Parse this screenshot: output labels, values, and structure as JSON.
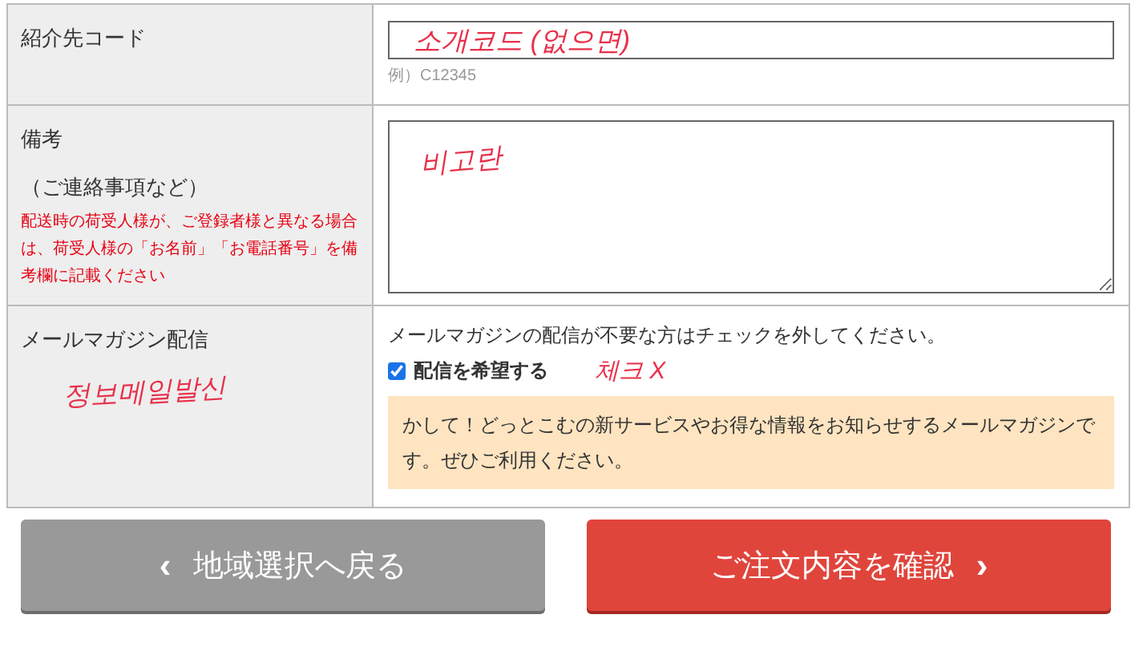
{
  "rows": [
    {
      "kind": "input",
      "label": "紹介先コード",
      "annotation": "소개코드  (없으면)",
      "hint": "例）C12345"
    },
    {
      "kind": "textarea",
      "label": "備考",
      "sublabel": "（ご連絡事項など）",
      "note": "配送時の荷受人様が、ご登録者様と異なる場合は、荷受人様の「お名前」「お電話番号」を備考欄に記載ください",
      "annotation": "비고란"
    },
    {
      "kind": "newsletter",
      "label": "メールマガジン配信",
      "label_annotation": "정보메일발신",
      "intro": "メールマガジンの配信が不要な方はチェックを外してください。",
      "checkbox": {
        "label": "配信を希望する",
        "checked": true
      },
      "annotation": "체크 X",
      "info": "かして！どっとこむの新サービスやお得な情報をお知らせするメールマガジンです。ぜひご利用ください。"
    }
  ],
  "buttons": [
    {
      "kind": "back",
      "label": "地域選択へ戻る",
      "icon": "‹"
    },
    {
      "kind": "next",
      "label": "ご注文内容を確認",
      "icon": "›"
    }
  ]
}
